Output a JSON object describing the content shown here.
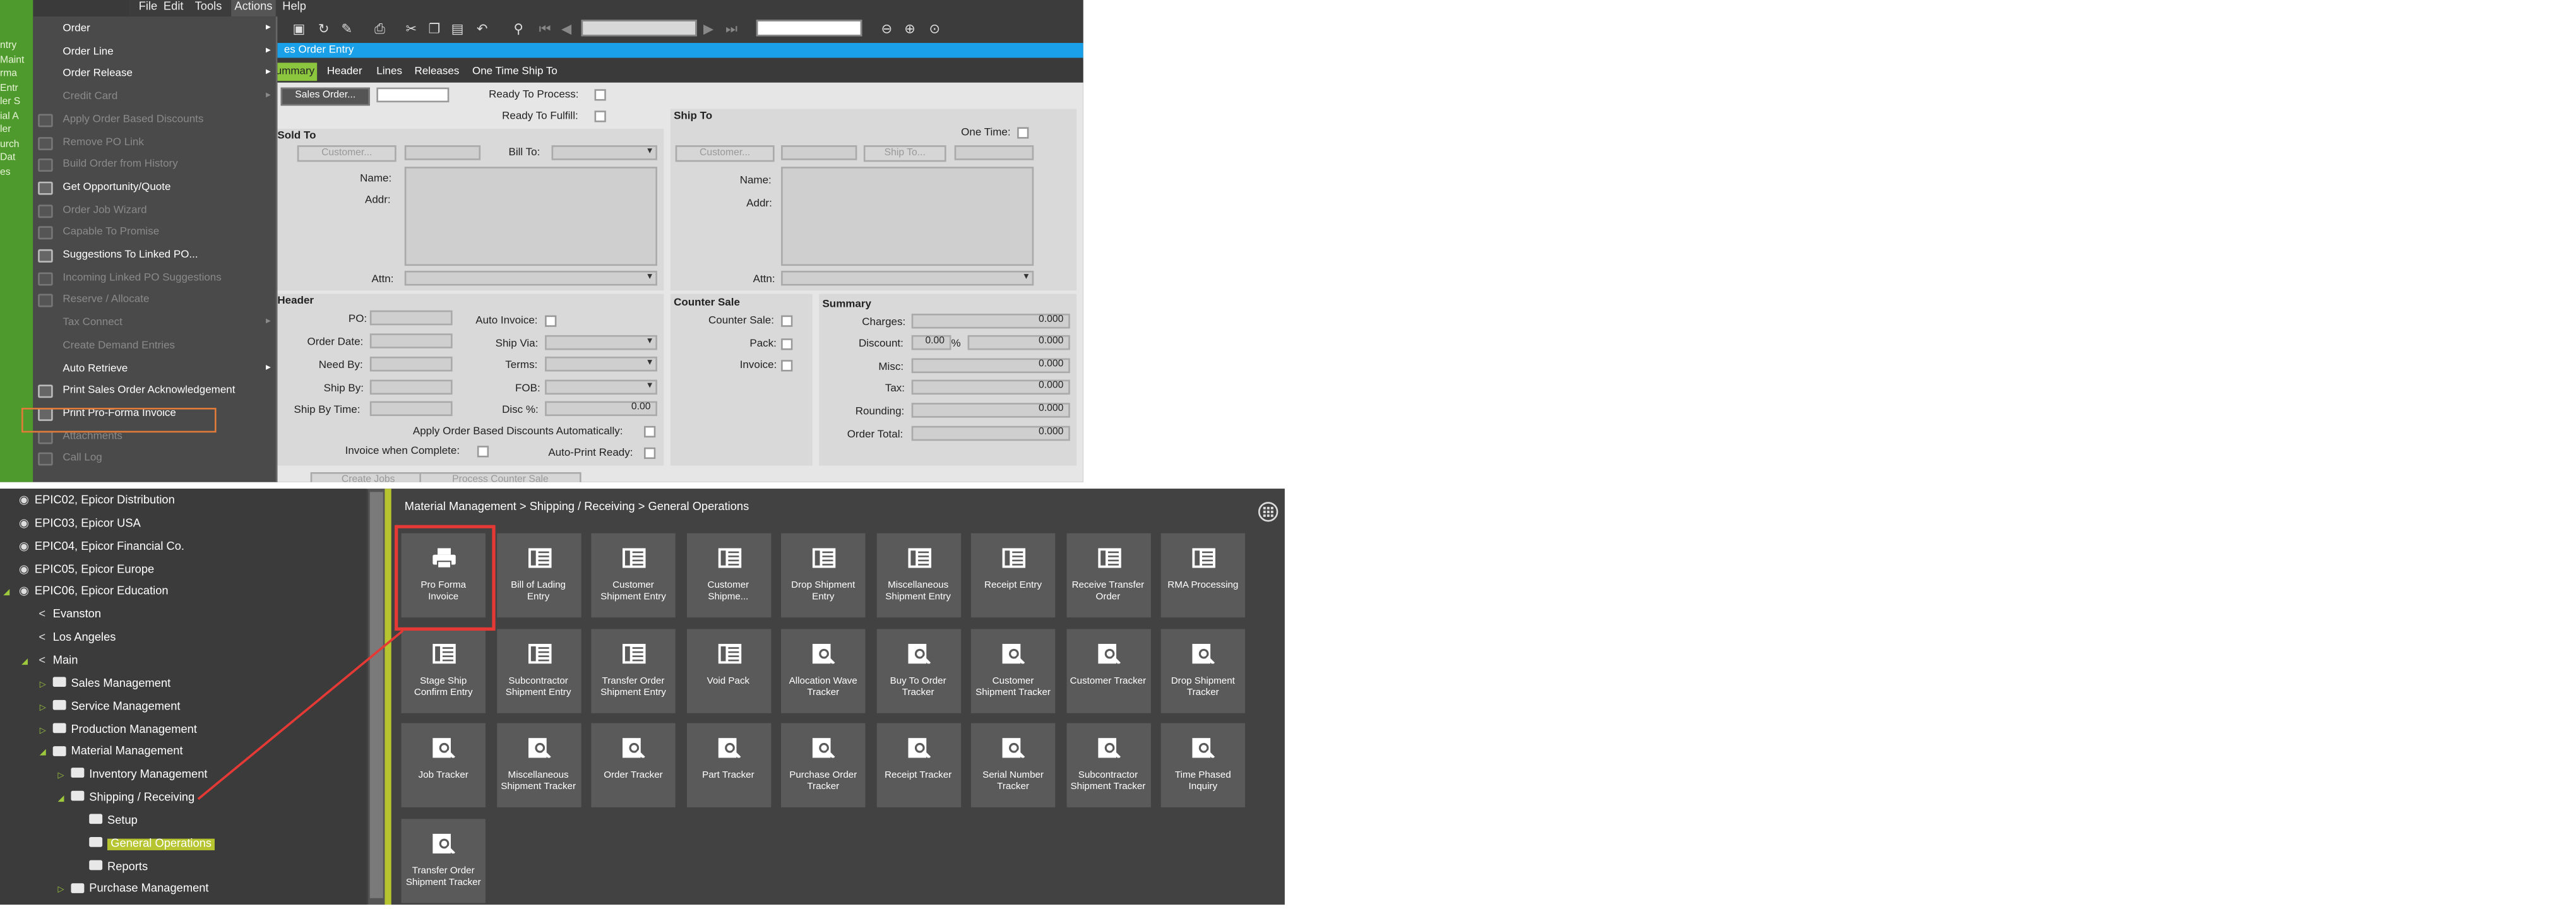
{
  "top": {
    "left_strip_text": [
      "ntry",
      "Maint",
      "rma",
      "Entr",
      "ler S",
      "ial A",
      "ler",
      "",
      "urch",
      "Dat",
      "",
      "es",
      ""
    ],
    "menubar": [
      "File",
      "Edit",
      "Tools",
      "Actions",
      "Help"
    ],
    "title": "es Order Entry",
    "tabs": [
      "ummary",
      "Header",
      "Lines",
      "Releases",
      "One Time Ship To"
    ],
    "form": {
      "sales_order_btn": "Sales Order...",
      "ready_to_process": "Ready To Process:",
      "ready_to_fulfill": "Ready To Fulfill:",
      "sold_to": "Sold To",
      "customer_btn": "Customer...",
      "bill_to": "Bill To:",
      "name": "Name:",
      "addr": "Addr:",
      "attn": "Attn:",
      "ship_to": "Ship To",
      "one_time": "One Time:",
      "ship_to_btn": "Ship To...",
      "header": "Header",
      "po": "PO:",
      "order_date": "Order Date:",
      "need_by": "Need By:",
      "ship_by": "Ship By:",
      "ship_by_time": "Ship By Time:",
      "auto_invoice": "Auto Invoice:",
      "ship_via": "Ship Via:",
      "terms": "Terms:",
      "fob": "FOB:",
      "disc": "Disc %:",
      "disc_value": "0.00",
      "apply_discounts": "Apply Order Based Discounts Automatically:",
      "invoice_when_complete": "Invoice when Complete:",
      "auto_print_ready": "Auto-Print Ready:",
      "counter_sale": "Counter Sale",
      "counter_sale_chk": "Counter Sale:",
      "pack": "Pack:",
      "invoice": "Invoice:",
      "summary": "Summary",
      "charges": "Charges:",
      "discount": "Discount:",
      "discount_pct": "0.00",
      "pct_sign": "%",
      "misc": "Misc:",
      "tax": "Tax:",
      "rounding": "Rounding:",
      "order_total": "Order Total:",
      "zero": "0.000",
      "create_jobs": "Create Jobs",
      "process_counter_sale": "Process Counter Sale"
    },
    "menu": [
      {
        "label": "Order",
        "arrow": true,
        "disabled": false,
        "icon": false
      },
      {
        "label": "Order Line",
        "arrow": true,
        "disabled": false,
        "icon": false
      },
      {
        "label": "Order Release",
        "arrow": true,
        "disabled": false,
        "icon": false
      },
      {
        "label": "Credit Card",
        "arrow": true,
        "disabled": true,
        "icon": false
      },
      {
        "label": "Apply Order Based Discounts",
        "arrow": false,
        "disabled": true,
        "icon": true
      },
      {
        "label": "Remove PO Link",
        "arrow": false,
        "disabled": true,
        "icon": true
      },
      {
        "label": "Build Order from History",
        "arrow": false,
        "disabled": true,
        "icon": true
      },
      {
        "label": "Get Opportunity/Quote",
        "arrow": false,
        "disabled": false,
        "icon": true
      },
      {
        "label": "Order Job Wizard",
        "arrow": false,
        "disabled": true,
        "icon": true
      },
      {
        "label": "Capable To Promise",
        "arrow": false,
        "disabled": true,
        "icon": true
      },
      {
        "label": "Suggestions To Linked PO...",
        "arrow": false,
        "disabled": false,
        "icon": true
      },
      {
        "label": "Incoming Linked PO Suggestions",
        "arrow": false,
        "disabled": true,
        "icon": true
      },
      {
        "label": "Reserve / Allocate",
        "arrow": false,
        "disabled": true,
        "icon": true
      },
      {
        "label": "Tax Connect",
        "arrow": true,
        "disabled": true,
        "icon": false
      },
      {
        "label": "Create Demand Entries",
        "arrow": false,
        "disabled": true,
        "icon": false
      },
      {
        "label": "Auto Retrieve",
        "arrow": true,
        "disabled": false,
        "icon": false
      },
      {
        "label": "Print Sales Order Acknowledgement",
        "arrow": false,
        "disabled": false,
        "icon": true
      },
      {
        "label": "Print Pro-Forma Invoice",
        "arrow": false,
        "disabled": false,
        "icon": true
      },
      {
        "label": "Attachments",
        "arrow": false,
        "disabled": true,
        "icon": true
      },
      {
        "label": "Call Log",
        "arrow": false,
        "disabled": true,
        "icon": true
      }
    ]
  },
  "bottom": {
    "breadcrumb": "Material Management > Shipping / Receiving > General Operations",
    "tree": [
      {
        "label": "EPIC02, Epicor Distribution",
        "indent": 0,
        "kind": "globe",
        "exp": ""
      },
      {
        "label": "EPIC03, Epicor USA",
        "indent": 0,
        "kind": "globe",
        "exp": ""
      },
      {
        "label": "EPIC04, Epicor Financial Co.",
        "indent": 0,
        "kind": "globe",
        "exp": ""
      },
      {
        "label": "EPIC05, Epicor Europe",
        "indent": 0,
        "kind": "globe",
        "exp": ""
      },
      {
        "label": "EPIC06, Epicor Education",
        "indent": 0,
        "kind": "globe",
        "exp": "open"
      },
      {
        "label": "Evanston",
        "indent": 1,
        "kind": "share",
        "exp": ""
      },
      {
        "label": "Los Angeles",
        "indent": 1,
        "kind": "share",
        "exp": ""
      },
      {
        "label": "Main",
        "indent": 1,
        "kind": "share",
        "exp": "open"
      },
      {
        "label": "Sales Management",
        "indent": 2,
        "kind": "folder",
        "exp": "closed"
      },
      {
        "label": "Service Management",
        "indent": 2,
        "kind": "folder",
        "exp": "closed"
      },
      {
        "label": "Production Management",
        "indent": 2,
        "kind": "folder",
        "exp": "closed"
      },
      {
        "label": "Material Management",
        "indent": 2,
        "kind": "folder",
        "exp": "open"
      },
      {
        "label": "Inventory Management",
        "indent": 3,
        "kind": "folder",
        "exp": "closed"
      },
      {
        "label": "Shipping / Receiving",
        "indent": 3,
        "kind": "folder",
        "exp": "open"
      },
      {
        "label": "Setup",
        "indent": 4,
        "kind": "folder",
        "exp": ""
      },
      {
        "label": "General Operations",
        "indent": 4,
        "kind": "folder",
        "exp": "",
        "selected": true
      },
      {
        "label": "Reports",
        "indent": 4,
        "kind": "folder",
        "exp": ""
      },
      {
        "label": "Purchase Management",
        "indent": 3,
        "kind": "folder",
        "exp": "closed"
      }
    ],
    "tiles": [
      {
        "label": "Pro Forma Invoice",
        "icon": "printer-icon"
      },
      {
        "label": "Bill of Lading Entry",
        "icon": "form-icon"
      },
      {
        "label": "Customer Shipment Entry",
        "icon": "form-icon"
      },
      {
        "label": "Customer Shipme...",
        "icon": "form-icon"
      },
      {
        "label": "Drop Shipment Entry",
        "icon": "form-icon"
      },
      {
        "label": "Miscellaneous Shipment Entry",
        "icon": "form-icon"
      },
      {
        "label": "Receipt Entry",
        "icon": "form-icon"
      },
      {
        "label": "Receive Transfer Order",
        "icon": "form-icon"
      },
      {
        "label": "RMA Processing",
        "icon": "form-icon"
      },
      {
        "label": "Stage Ship Confirm Entry",
        "icon": "form-icon"
      },
      {
        "label": "Subcontractor Shipment Entry",
        "icon": "form-icon"
      },
      {
        "label": "Transfer Order Shipment Entry",
        "icon": "form-icon"
      },
      {
        "label": "Void Pack",
        "icon": "form-icon"
      },
      {
        "label": "Allocation Wave Tracker",
        "icon": "tracker-icon"
      },
      {
        "label": "Buy To Order Tracker",
        "icon": "tracker-icon"
      },
      {
        "label": "Customer Shipment Tracker",
        "icon": "tracker-icon"
      },
      {
        "label": "Customer Tracker",
        "icon": "tracker-icon"
      },
      {
        "label": "Drop Shipment Tracker",
        "icon": "tracker-icon"
      },
      {
        "label": "Job Tracker",
        "icon": "tracker-icon"
      },
      {
        "label": "Miscellaneous Shipment Tracker",
        "icon": "tracker-icon"
      },
      {
        "label": "Order Tracker",
        "icon": "tracker-icon"
      },
      {
        "label": "Part Tracker",
        "icon": "tracker-icon"
      },
      {
        "label": "Purchase Order Tracker",
        "icon": "tracker-icon"
      },
      {
        "label": "Receipt Tracker",
        "icon": "tracker-icon"
      },
      {
        "label": "Serial Number Tracker",
        "icon": "tracker-icon"
      },
      {
        "label": "Subcontractor Shipment Tracker",
        "icon": "tracker-icon"
      },
      {
        "label": "Time Phased Inquiry",
        "icon": "tracker-icon"
      },
      {
        "label": "Transfer Order Shipment Tracker",
        "icon": "tracker-icon"
      }
    ]
  },
  "colors": {
    "accent_green": "#8cc63f",
    "title_blue": "#1aa0e8",
    "menu_highlight": "#e07b39",
    "tile_highlight": "#e53935",
    "tree_selected": "#b6c42f"
  }
}
